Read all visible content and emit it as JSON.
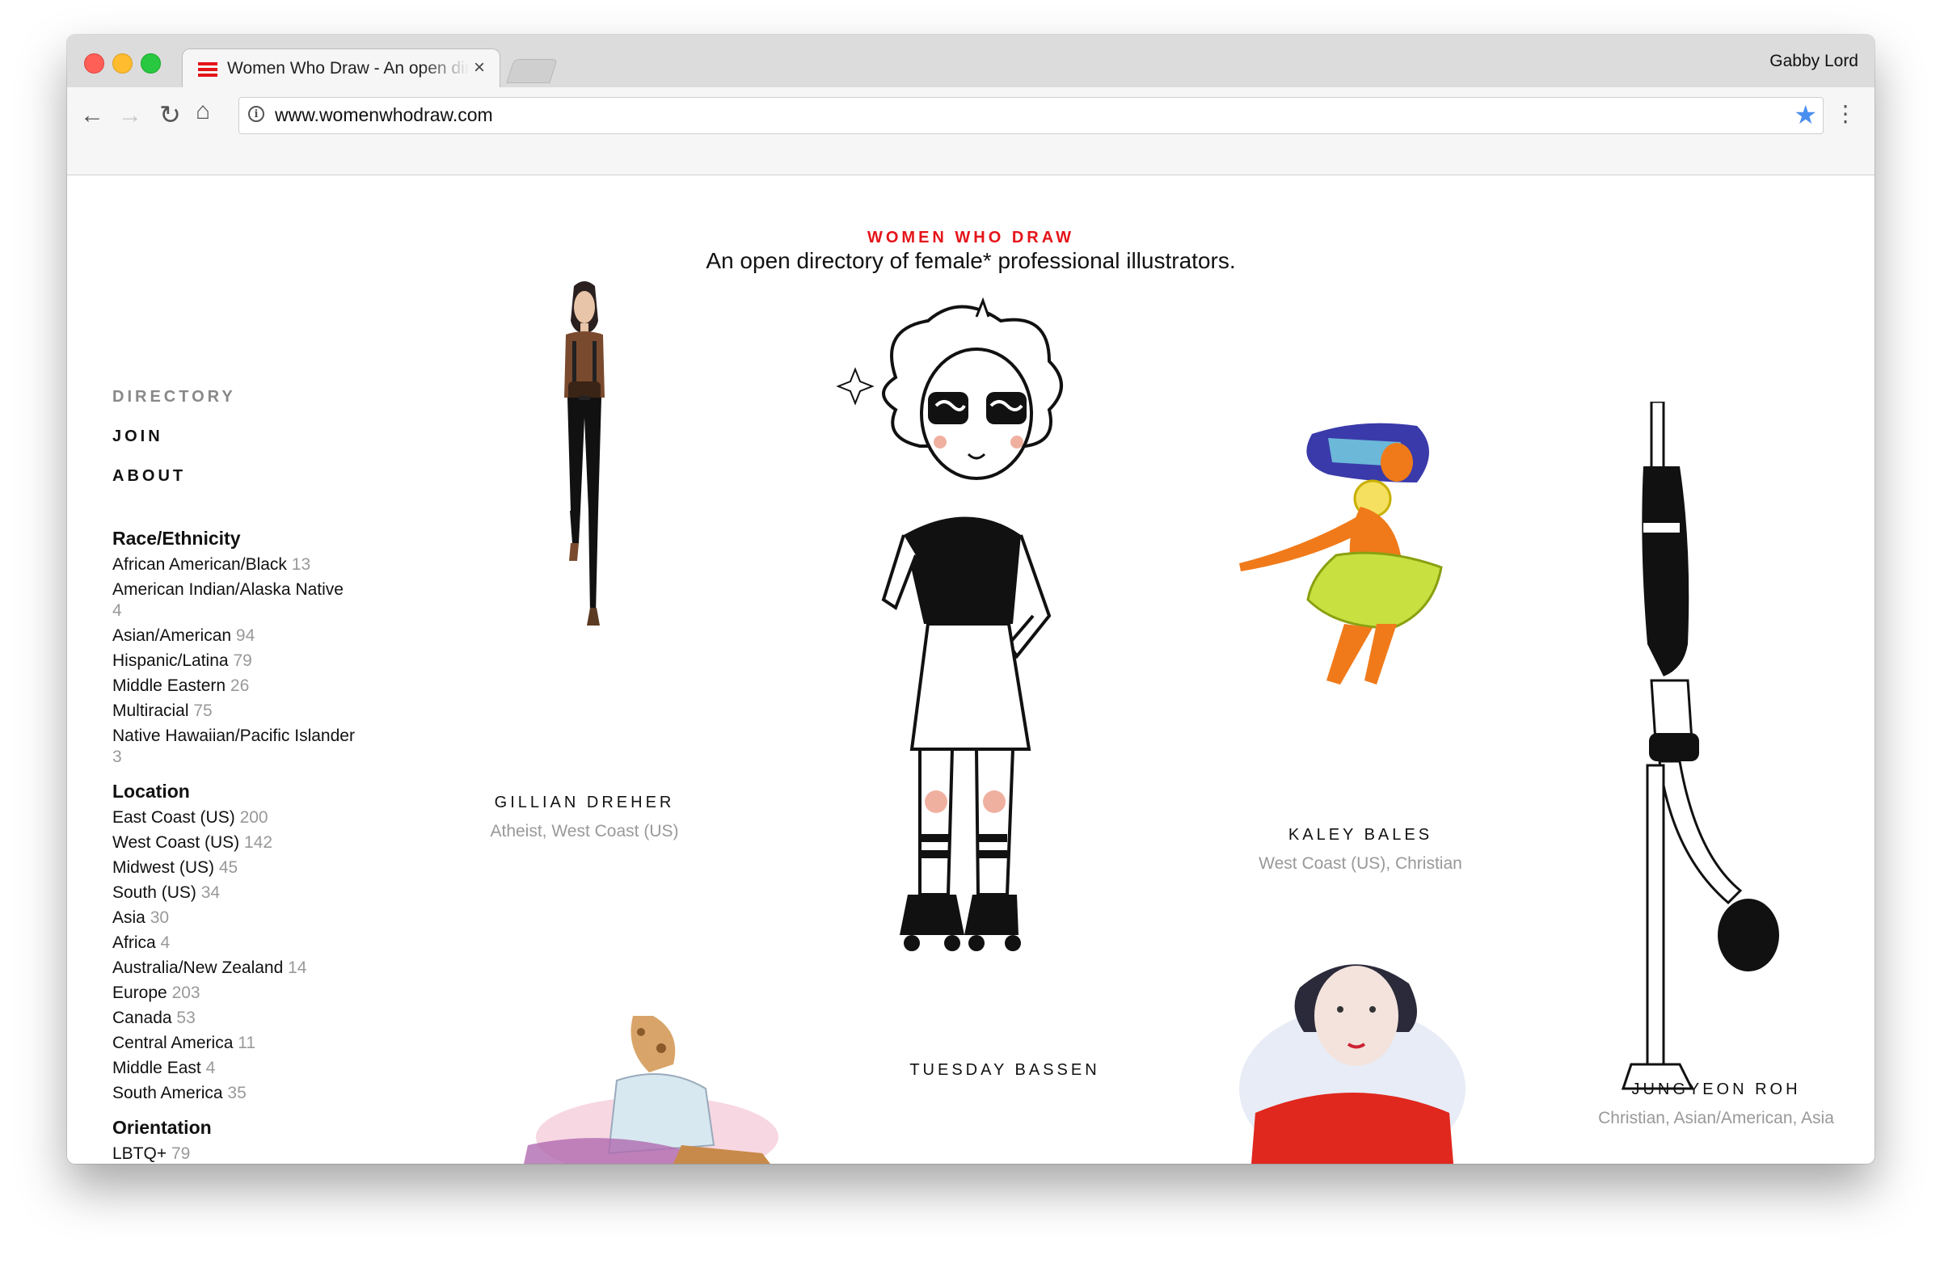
{
  "browser": {
    "tab_title": "Women Who Draw - An open directory of female* professional illustrators",
    "tab_close": "×",
    "profile_name": "Gabby Lord",
    "url": "www.womenwhodraw.com",
    "icons": {
      "back": "←",
      "forward": "→",
      "reload": "↻",
      "home": "⌂",
      "info": "i",
      "star": "★",
      "menu": "⋮"
    }
  },
  "header": {
    "site_name": "WOMEN WHO DRAW",
    "tagline": "An open directory of female* professional illustrators."
  },
  "sidebar": {
    "nav": [
      {
        "label": "DIRECTORY"
      },
      {
        "label": "JOIN"
      },
      {
        "label": "ABOUT"
      }
    ],
    "filters": [
      {
        "heading": "Race/Ethnicity",
        "items": [
          {
            "label": "African American/Black",
            "count": "13"
          },
          {
            "label": "American Indian/Alaska Native",
            "count": "4"
          },
          {
            "label": "Asian/American",
            "count": "94"
          },
          {
            "label": "Hispanic/Latina",
            "count": "79"
          },
          {
            "label": "Middle Eastern",
            "count": "26"
          },
          {
            "label": "Multiracial",
            "count": "75"
          },
          {
            "label": "Native Hawaiian/Pacific Islander",
            "count": "3"
          }
        ]
      },
      {
        "heading": "Location",
        "items": [
          {
            "label": "East Coast (US)",
            "count": "200"
          },
          {
            "label": "West Coast (US)",
            "count": "142"
          },
          {
            "label": "Midwest (US)",
            "count": "45"
          },
          {
            "label": "South (US)",
            "count": "34"
          },
          {
            "label": "Asia",
            "count": "30"
          },
          {
            "label": "Africa",
            "count": "4"
          },
          {
            "label": "Australia/New Zealand",
            "count": "14"
          },
          {
            "label": "Europe",
            "count": "203"
          },
          {
            "label": "Canada",
            "count": "53"
          },
          {
            "label": "Central America",
            "count": "11"
          },
          {
            "label": "Middle East",
            "count": "4"
          },
          {
            "label": "South America",
            "count": "35"
          }
        ]
      },
      {
        "heading": "Orientation",
        "items": [
          {
            "label": "LBTQ+",
            "count": "79"
          }
        ]
      }
    ]
  },
  "artists": [
    {
      "name": "GILLIAN DREHER",
      "tags": "Atheist, West Coast (US)"
    },
    {
      "name": "TUESDAY BASSEN",
      "tags": ""
    },
    {
      "name": "KALEY BALES",
      "tags": "West Coast (US), Christian"
    },
    {
      "name": "JUNGYEON ROH",
      "tags": "Christian, Asian/American, Asia"
    }
  ],
  "colors": {
    "accent": "#e5141a",
    "muted": "#999999",
    "link_star": "#4a8ef0"
  }
}
